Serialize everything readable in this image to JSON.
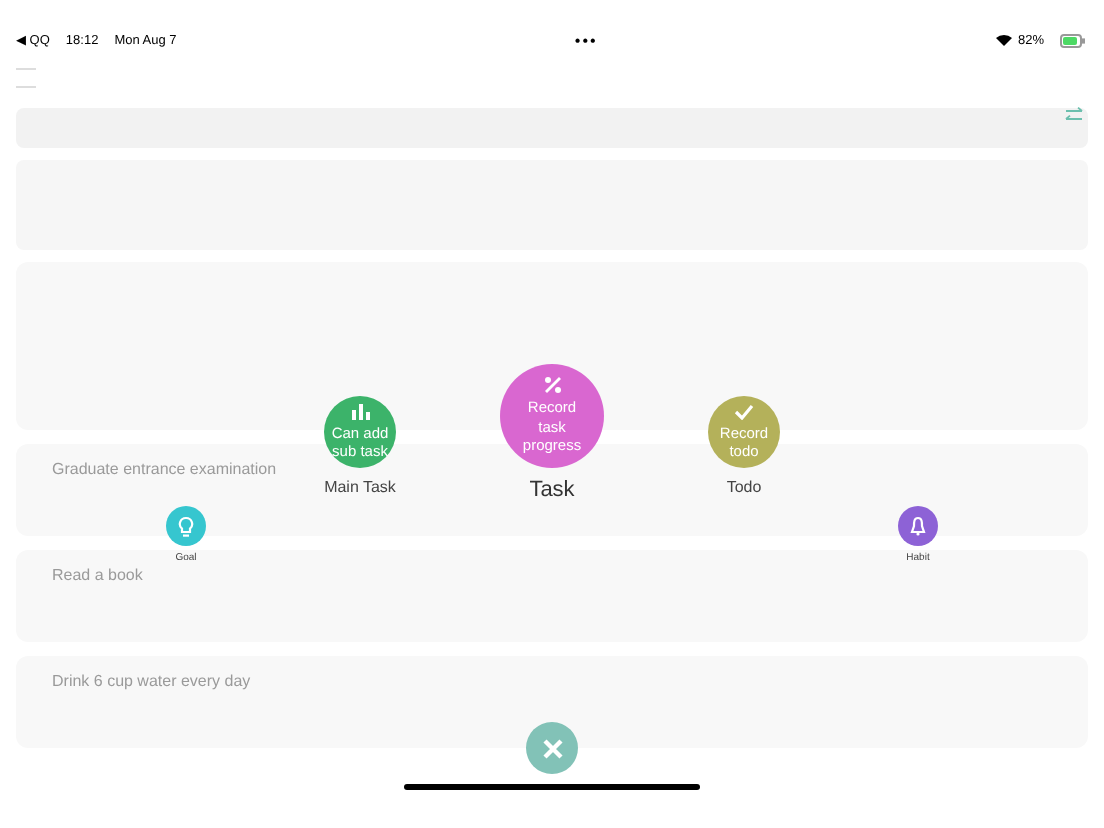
{
  "status_bar": {
    "back": "◀ QQ",
    "time": "18:12",
    "date": "Mon Aug 7",
    "dots": "•••",
    "battery": "82%"
  },
  "background_tasks": [
    {
      "title": "Graduate entrance examination"
    },
    {
      "title": "Read a book"
    },
    {
      "title": "Drink 6 cup water every day"
    }
  ],
  "menu": {
    "options": [
      {
        "kind": "medium",
        "label": "Main Task",
        "button_text": "Can add sub task",
        "color": "#3cb36a"
      },
      {
        "kind": "large",
        "label": "Task",
        "button_text": "Record task progress",
        "color": "#d967d0"
      },
      {
        "kind": "medium",
        "label": "Todo",
        "button_text": "Record todo",
        "color": "#b4b15a"
      },
      {
        "kind": "small",
        "label": "Goal",
        "color": "#36c6cf"
      },
      {
        "kind": "small",
        "label": "Habit",
        "color": "#8d62d6"
      }
    ]
  }
}
